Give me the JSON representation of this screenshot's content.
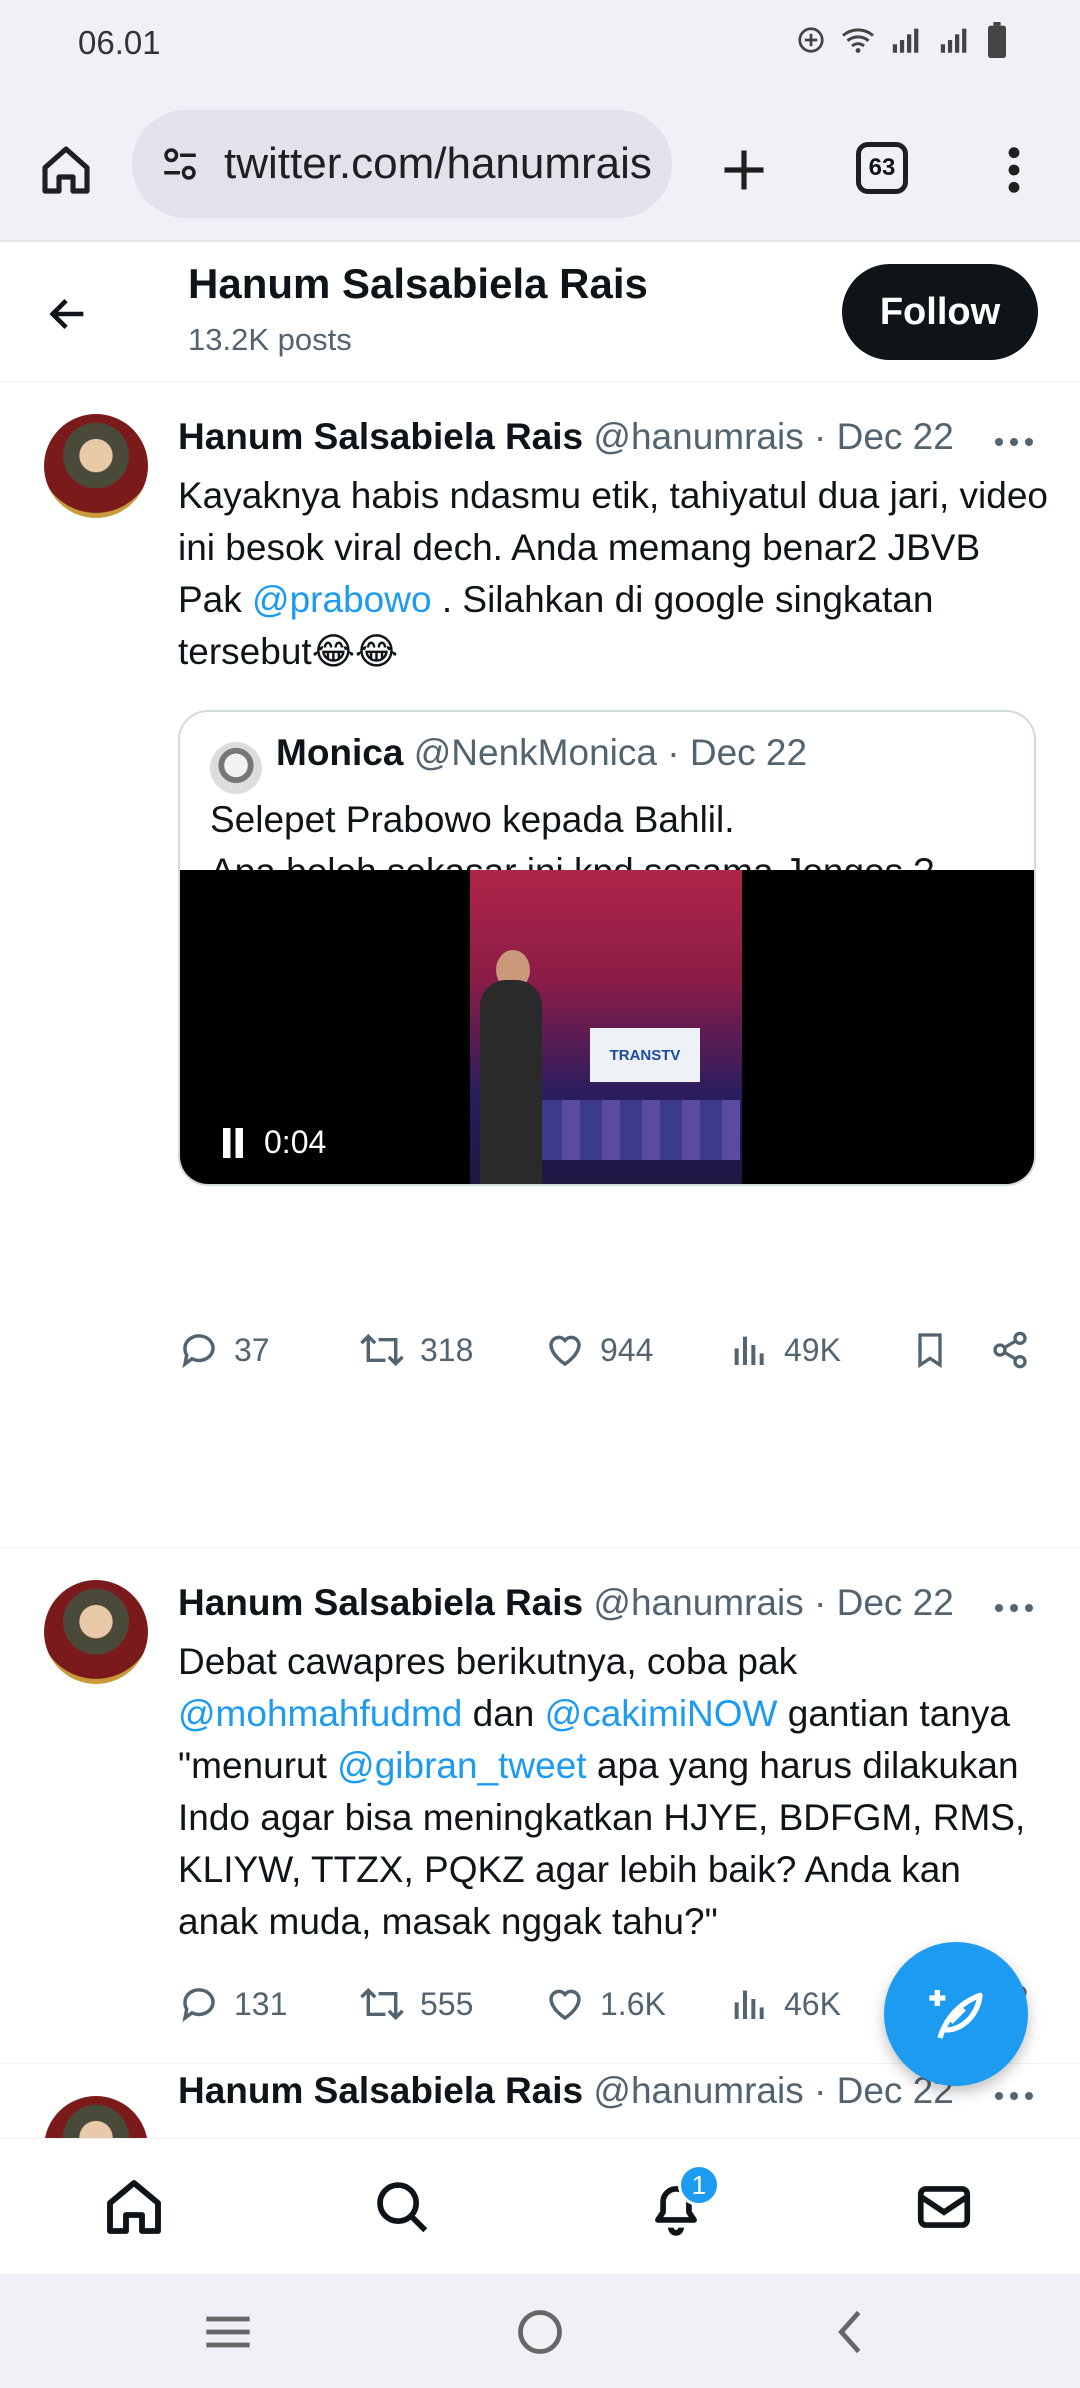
{
  "status_bar": {
    "time": "06.01"
  },
  "browser": {
    "url": "twitter.com/hanumrais",
    "tab_count": "63"
  },
  "profile_header": {
    "name": "Hanum Salsabiela Rais",
    "posts": "13.2K posts",
    "follow_label": "Follow"
  },
  "tweets": [
    {
      "name": "Hanum Salsabiela Rais",
      "handle": "@hanumrais",
      "sep": "·",
      "date": "Dec 22",
      "text_a": "Kayaknya habis ndasmu etik, tahiyatul dua jari, video ini besok viral dech. Anda memang benar2 JBVB Pak ",
      "mention_1": "@prabowo",
      "text_b": " . Silahkan di google singkatan tersebut😂😂",
      "quote": {
        "name": "Monica",
        "handle": "@NenkMonica",
        "sep": "·",
        "date": "Dec 22",
        "line_1": "Selepet Prabowo kepada Bahlil.",
        "line_2": "Apa boleh sekasar ini kpd sesama Jongos ?",
        "video_time": "0:04",
        "video_banner": "TRANSTV"
      },
      "replies": "37",
      "reposts": "318",
      "likes": "944",
      "views": "49K"
    },
    {
      "name": "Hanum Salsabiela Rais",
      "handle": "@hanumrais",
      "sep": "·",
      "date": "Dec 22",
      "text_a": "Debat cawapres berikutnya, coba pak ",
      "mention_1": "@mohmahfudmd",
      "text_b": " dan ",
      "mention_2": "@cakimiNOW",
      "text_c": " gantian tanya \"menurut ",
      "mention_3": "@gibran_tweet",
      "text_d": " apa yang harus dilakukan Indo agar bisa meningkatkan HJYE, BDFGM, RMS, KLIYW, TTZX, PQKZ agar lebih baik? Anda kan anak muda, masak nggak tahu?\"",
      "replies": "131",
      "reposts": "555",
      "likes": "1.6K",
      "views": "46K"
    },
    {
      "name": "Hanum Salsabiela Rais",
      "handle": "@hanumrais",
      "sep": "·",
      "date": "Dec 22"
    }
  ],
  "nav": {
    "notification_count": "1"
  },
  "colors": {
    "accent": "#1d9bf0",
    "text": "#0f1419",
    "muted": "#536471"
  }
}
